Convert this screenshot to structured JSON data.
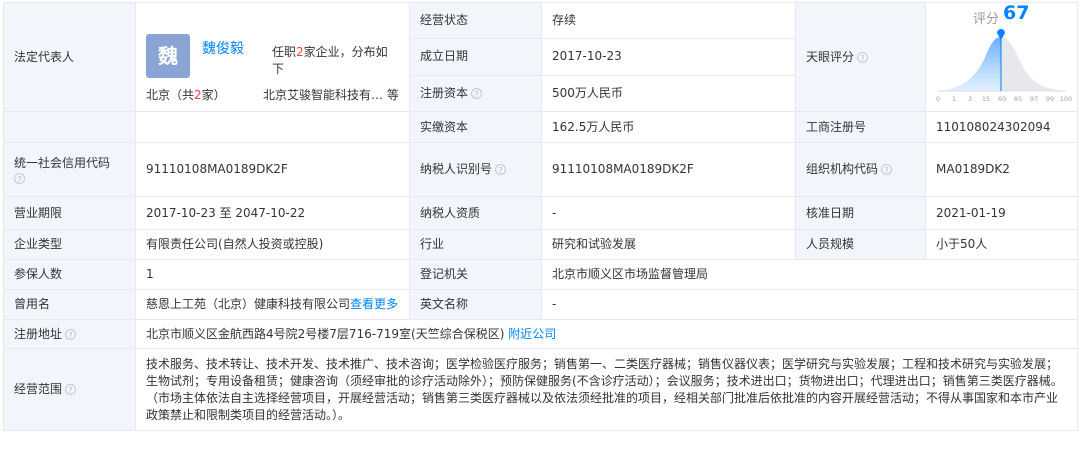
{
  "legal_rep": {
    "label": "法定代表人",
    "avatar_char": "魏",
    "name": "魏俊毅",
    "role_prefix": "任职",
    "role_count": "2",
    "role_suffix": "家企业，分布如下",
    "region_prefix": "北京（共",
    "region_count": "2",
    "region_suffix": "家）",
    "company": "北京艾骏智能科技有…",
    "more": "等"
  },
  "status": {
    "label": "经营状态",
    "value": "存续"
  },
  "founded": {
    "label": "成立日期",
    "value": "2017-10-23"
  },
  "reg_capital": {
    "label": "注册资本",
    "value": "500万人民币"
  },
  "paid_capital": {
    "label": "实缴资本",
    "value": "162.5万人民币"
  },
  "tianyan": {
    "label": "天眼评分",
    "score_label": "评分",
    "score": "67",
    "ticks": [
      "0",
      "1",
      "3",
      "15",
      "60",
      "85",
      "97",
      "99",
      "100"
    ],
    "accent": "#0084ff"
  },
  "biz_reg_no": {
    "label": "工商注册号",
    "value": "110108024302094"
  },
  "credit_code": {
    "label": "统一社会信用代码",
    "value": "91110108MA0189DK2F"
  },
  "taxpayer_id": {
    "label": "纳税人识别号",
    "value": "91110108MA0189DK2F"
  },
  "org_code": {
    "label": "组织机构代码",
    "value": "MA0189DK2"
  },
  "term": {
    "label": "营业期限",
    "value": "2017-10-23 至 2047-10-22"
  },
  "taxpayer_qual": {
    "label": "纳税人资质",
    "value": "-"
  },
  "approval_date": {
    "label": "核准日期",
    "value": "2021-01-19"
  },
  "company_type": {
    "label": "企业类型",
    "value": "有限责任公司(自然人投资或控股)"
  },
  "industry": {
    "label": "行业",
    "value": "研究和试验发展"
  },
  "staff_size": {
    "label": "人员规模",
    "value": "小于50人"
  },
  "insured": {
    "label": "参保人数",
    "value": "1"
  },
  "reg_authority": {
    "label": "登记机关",
    "value": "北京市顺义区市场监督管理局"
  },
  "former_name": {
    "label": "曾用名",
    "value": "慈恩上工苑（北京）健康科技有限公司",
    "link": "查看更多"
  },
  "english_name": {
    "label": "英文名称",
    "value": "-"
  },
  "address": {
    "label": "注册地址",
    "value": "北京市顺义区金航西路4号院2号楼7层716-719室(天竺综合保税区)",
    "link": "附近公司"
  },
  "scope": {
    "label": "经营范围",
    "value": "技术服务、技术转让、技术开发、技术推广、技术咨询；医学检验医疗服务；销售第一、二类医疗器械；销售仪器仪表；医学研究与实验发展；工程和技术研究与实验发展；生物试剂；专用设备租赁；健康咨询（须经审批的诊疗活动除外）；预防保健服务(不含诊疗活动）；会议服务；技术进出口；货物进出口；代理进出口；销售第三类医疗器械。（市场主体依法自主选择经营项目，开展经营活动；销售第三类医疗器械以及依法须经批准的项目，经相关部门批准后依批准的内容开展经营活动；不得从事国家和本市产业政策禁止和限制类项目的经营活动。）。"
  },
  "help_icon": "?"
}
